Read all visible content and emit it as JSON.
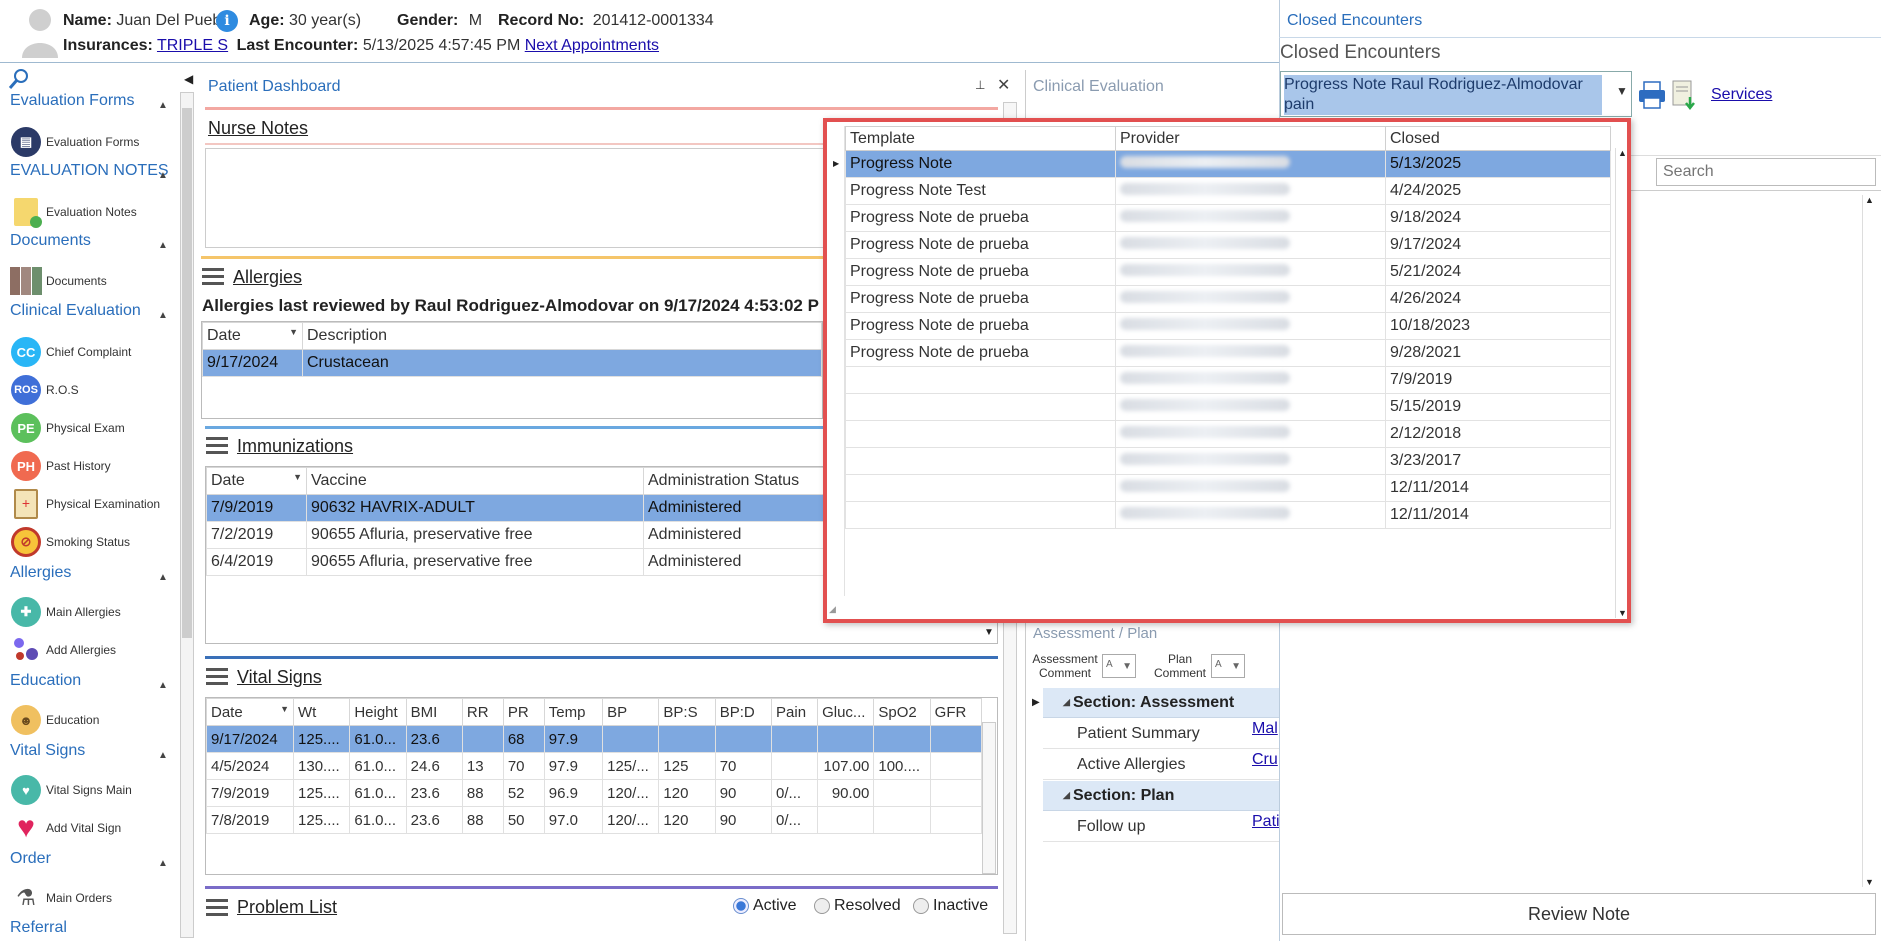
{
  "header": {
    "name_label": "Name:",
    "name_value": "Juan Del Pueblo",
    "age_label": "Age:",
    "age_value": "30 year(s)",
    "gender_label": "Gender:",
    "gender_value": "M",
    "record_label": "Record No:",
    "record_value": "201412-0001334",
    "insurances_label": "Insurances:",
    "insurances_value": "TRIPLE S",
    "last_encounter_label": "Last Encounter:",
    "last_encounter_value": "5/13/2025 4:57:45 PM",
    "next_appointments": "Next Appointments"
  },
  "closed_encounters": {
    "tab_title": "Closed Encounters",
    "heading": "Closed Encounters",
    "selected": "Progress Note Raul Rodriguez-Almodovar pain",
    "services_link": "Services",
    "search_placeholder": "Search",
    "review_note": "Review Note"
  },
  "sidebar": {
    "sections": [
      {
        "title": "Evaluation Forms",
        "items": [
          "Evaluation Forms"
        ]
      },
      {
        "title": "EVALUATION NOTES",
        "items": [
          "Evaluation Notes"
        ]
      },
      {
        "title": "Documents",
        "items": [
          "Documents"
        ]
      },
      {
        "title": "Clinical Evaluation",
        "items": [
          "Chief Complaint",
          "R.O.S",
          "Physical Exam",
          "Past History",
          "Physical Examination",
          "Smoking Status"
        ]
      },
      {
        "title": "Allergies",
        "items": [
          "Main Allergies",
          "Add Allergies"
        ]
      },
      {
        "title": "Education",
        "items": [
          "Education"
        ]
      },
      {
        "title": "Vital Signs",
        "items": [
          "Vital Signs Main",
          "Add Vital Sign"
        ]
      },
      {
        "title": "Order",
        "items": [
          "Main Orders"
        ]
      },
      {
        "title": "Referral",
        "items": []
      }
    ],
    "icon_text": {
      "cc": "CC",
      "ros": "ROS",
      "pe": "PE",
      "ph": "PH"
    }
  },
  "dashboard": {
    "title": "Patient Dashboard",
    "nurse_notes": "Nurse Notes",
    "allergies_title": "Allergies",
    "allergies_reviewed": "Allergies last reviewed by Raul Rodriguez-Almodovar on 9/17/2024 4:53:02 P",
    "allergies_columns": [
      "Date",
      "Description"
    ],
    "allergies_rows": [
      [
        "9/17/2024",
        "Crustacean"
      ]
    ],
    "immunizations_title": "Immunizations",
    "immunizations_columns": [
      "Date",
      "Vaccine",
      "Administration Status"
    ],
    "immunizations_rows": [
      [
        "7/9/2019",
        "90632 HAVRIX-ADULT",
        "Administered"
      ],
      [
        "7/2/2019",
        "90655 Afluria, preservative free",
        "Administered"
      ],
      [
        "6/4/2019",
        "90655 Afluria, preservative free",
        "Administered"
      ]
    ],
    "vitals_title": "Vital Signs",
    "vitals_columns": [
      "Date",
      "Wt",
      "Height",
      "BMI",
      "RR",
      "PR",
      "Temp",
      "BP",
      "BP:S",
      "BP:D",
      "Pain",
      "Gluc...",
      "SpO2",
      "GFR"
    ],
    "vitals_rows": [
      [
        "9/17/2024",
        "125....",
        "61.0...",
        "23.6",
        "",
        "68",
        "97.9",
        "",
        "",
        "",
        "",
        "",
        "",
        ""
      ],
      [
        "4/5/2024",
        "130....",
        "61.0...",
        "24.6",
        "13",
        "70",
        "97.9",
        "125/...",
        "125",
        "70",
        "",
        "107.00",
        "100....",
        ""
      ],
      [
        "7/9/2019",
        "125....",
        "61.0...",
        "23.6",
        "88",
        "52",
        "96.9",
        "120/...",
        "120",
        "90",
        "0/...",
        "90.00",
        "",
        ""
      ],
      [
        "7/8/2019",
        "125....",
        "61.0...",
        "23.6",
        "88",
        "50",
        "97.0",
        "120/...",
        "120",
        "90",
        "0/...",
        "",
        "",
        ""
      ]
    ],
    "problem_list_title": "Problem List",
    "problem_filters": [
      "Active",
      "Resolved",
      "Inactive"
    ]
  },
  "clinical_evaluation": {
    "title": "Clinical Evaluation",
    "assessment_plan": "Assessment / Plan",
    "assessment_comment": "Assessment Comment",
    "plan_comment": "Plan Comment",
    "section_assessment": "Section: Assessment",
    "patient_summary": "Patient Summary",
    "patient_summary_value": "Mal",
    "active_allergies": "Active Allergies",
    "active_allergies_value": "Cru",
    "section_plan": "Section: Plan",
    "follow_up": "Follow up",
    "follow_up_value": "Pati"
  },
  "popup": {
    "columns": [
      "Template",
      "Provider",
      "Closed"
    ],
    "rows": [
      [
        "Progress Note",
        "",
        "5/13/2025"
      ],
      [
        "Progress Note Test",
        "",
        "4/24/2025"
      ],
      [
        "Progress Note de prueba",
        "",
        "9/18/2024"
      ],
      [
        "Progress Note de prueba",
        "",
        "9/17/2024"
      ],
      [
        "Progress Note de prueba",
        "",
        "5/21/2024"
      ],
      [
        "Progress Note de prueba",
        "",
        "4/26/2024"
      ],
      [
        "Progress Note de prueba",
        "",
        "10/18/2023"
      ],
      [
        "Progress Note de prueba",
        "",
        "9/28/2021"
      ],
      [
        "",
        "",
        "7/9/2019"
      ],
      [
        "",
        "",
        "5/15/2019"
      ],
      [
        "",
        "",
        "2/12/2018"
      ],
      [
        "",
        "",
        "3/23/2017"
      ],
      [
        "",
        "",
        "12/11/2014"
      ],
      [
        "",
        "",
        "12/11/2014"
      ]
    ]
  },
  "colors": {
    "accent": "#2a6ebb",
    "selection": "#7ea8e0",
    "popup_border": "#e25050"
  }
}
